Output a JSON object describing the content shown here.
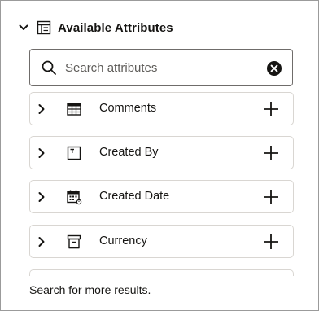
{
  "header": {
    "title": "Available Attributes",
    "collapse_icon": "chevron-down-icon",
    "panel_icon": "attributes-panel-icon"
  },
  "search": {
    "value": "",
    "placeholder": "Search attributes",
    "search_icon": "search-icon",
    "clear_icon": "clear-circle-icon"
  },
  "attributes": [
    {
      "label": "Comments",
      "icon": "table-icon"
    },
    {
      "label": "Created By",
      "icon": "text-field-icon"
    },
    {
      "label": "Created Date",
      "icon": "calendar-icon"
    },
    {
      "label": "Currency",
      "icon": "currency-field-icon"
    }
  ],
  "footer": {
    "more_results": "Search for more results."
  },
  "colors": {
    "text": "#161513",
    "border": "#d9d6d2",
    "search_border": "#6f6c6a"
  }
}
